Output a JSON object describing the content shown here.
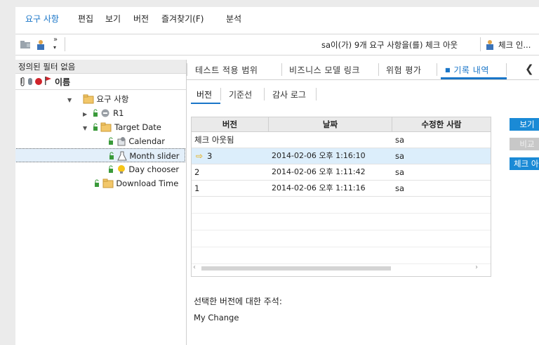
{
  "menu": {
    "items": [
      "요구 사항",
      "편집",
      "보기",
      "버전",
      "즐겨찾기(F)",
      "분석"
    ]
  },
  "toolbar": {
    "overflow": "»",
    "status": "sa이(가) 9개 요구 사항을(를) 체크 아웃",
    "checkin": "체크 인..."
  },
  "left_panel": {
    "filter_text": "정의된 필터 없음",
    "column_name": "이름",
    "tree": [
      {
        "label": "요구 사항",
        "icon": "folder-icon"
      },
      {
        "label": "R1",
        "icon": "requirement-icon"
      },
      {
        "label": "Target Date",
        "icon": "folder-icon"
      },
      {
        "label": "Calendar",
        "icon": "calendar-req-icon"
      },
      {
        "label": "Month slider",
        "icon": "flask-icon"
      },
      {
        "label": "Day chooser",
        "icon": "bulb-icon"
      },
      {
        "label": "Download Time",
        "icon": "folder-icon"
      }
    ]
  },
  "right_panel": {
    "tabs": [
      "테스트 적용 범위",
      "비즈니스 모델 링크",
      "위험 평가",
      "기록 내역"
    ],
    "active_tab": "기록 내역",
    "subtabs": [
      "버전",
      "기준선",
      "감사 로그"
    ],
    "grid": {
      "columns": [
        "버전",
        "날짜",
        "수정한 사람"
      ],
      "rows": [
        {
          "version": "체크 아웃됨",
          "date": "",
          "user": "sa"
        },
        {
          "version": "3",
          "date": "2014-02-06 오후 1:16:10",
          "user": "sa"
        },
        {
          "version": "2",
          "date": "2014-02-06 오후 1:11:42",
          "user": "sa"
        },
        {
          "version": "1",
          "date": "2014-02-06 오후 1:11:16",
          "user": "sa"
        }
      ]
    },
    "buttons": {
      "view": "보기",
      "compare": "비교",
      "checkout": "체크 아웃"
    },
    "notes_label": "선택한 버전에 대한 주석:",
    "notes_text": "My Change"
  },
  "colors": {
    "accent": "#1a76c8",
    "button": "#1a8ad6",
    "selection": "#dceefb"
  }
}
